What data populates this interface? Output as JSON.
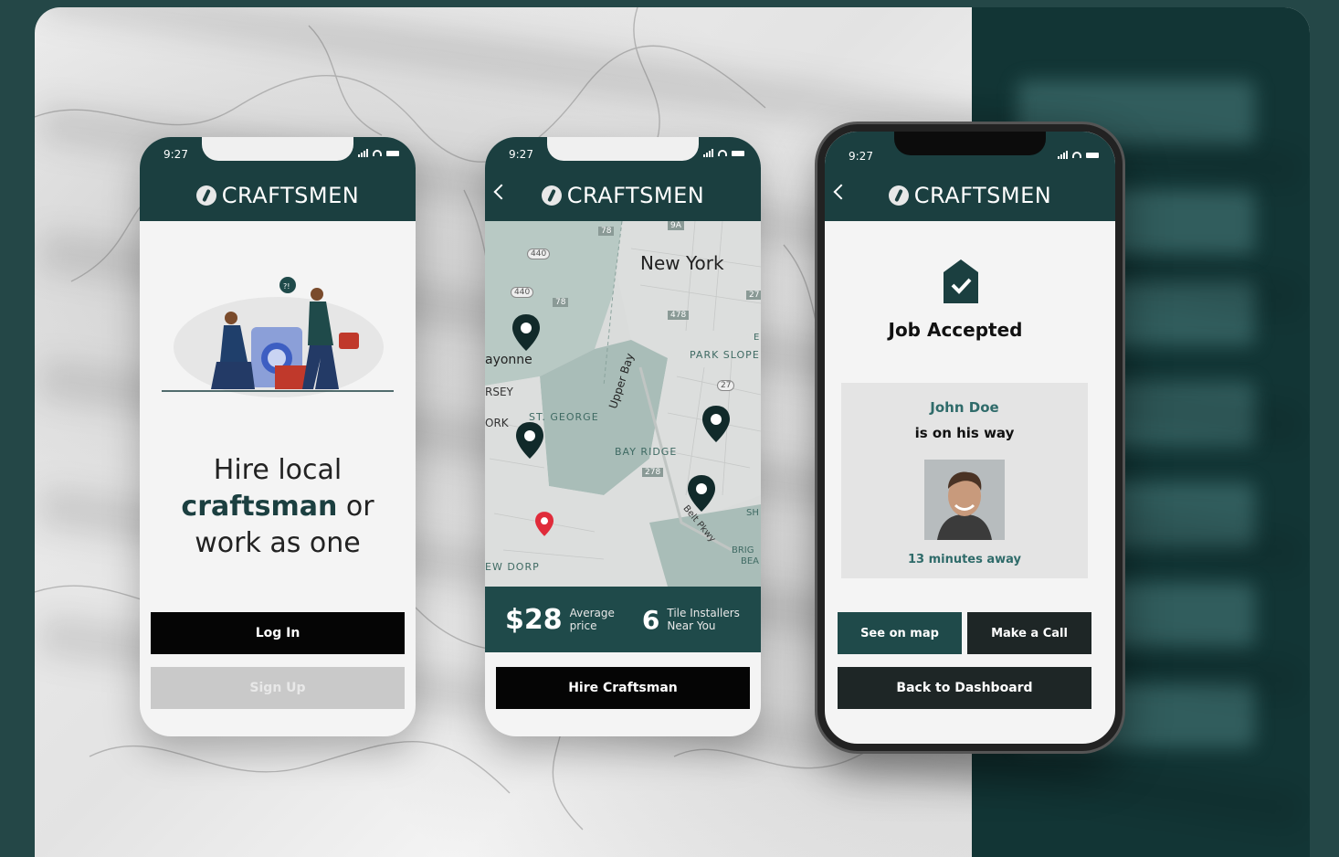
{
  "brand": "CRAFTSMEN",
  "status_time": "9:27",
  "colors": {
    "teal": "#1b3f40",
    "accent": "#2f6b6a",
    "pin_red": "#e02b3a",
    "background": "#244747"
  },
  "screen1": {
    "tagline_line1": "Hire local",
    "tagline_bold": "craftsman",
    "tagline_or": " or",
    "tagline_line3": "work as one",
    "login_label": "Log In",
    "signup_label": "Sign Up"
  },
  "screen2": {
    "map_labels": {
      "city": "New York",
      "bayonne": "ayonne",
      "jersey": "RSEY",
      "york": "ORK",
      "st_george": "ST. GEORGE",
      "upper_bay": "Upper Bay",
      "park_slope": "PARK SLOPE",
      "bay_ridge": "BAY RIDGE",
      "belt_pkwy": "Belt Pkwy",
      "dorp": "EW DORP",
      "brighton": "BRIG",
      "beach": "BEA",
      "sh": "SH",
      "e": "E"
    },
    "route_shields": [
      "440",
      "440",
      "78",
      "78",
      "478",
      "27",
      "27",
      "278",
      "9A"
    ],
    "price": "$28",
    "price_caption_1": "Average",
    "price_caption_2": "price",
    "count": "6",
    "count_caption_1": "Tile Installers",
    "count_caption_2": "Near You",
    "hire_label": "Hire Craftsman"
  },
  "screen3": {
    "title": "Job Accepted",
    "worker_name": "John Doe",
    "worker_status": "is on his way",
    "eta": "13 minutes away",
    "see_map_label": "See on map",
    "call_label": "Make a Call",
    "dashboard_label": "Back to Dashboard"
  }
}
